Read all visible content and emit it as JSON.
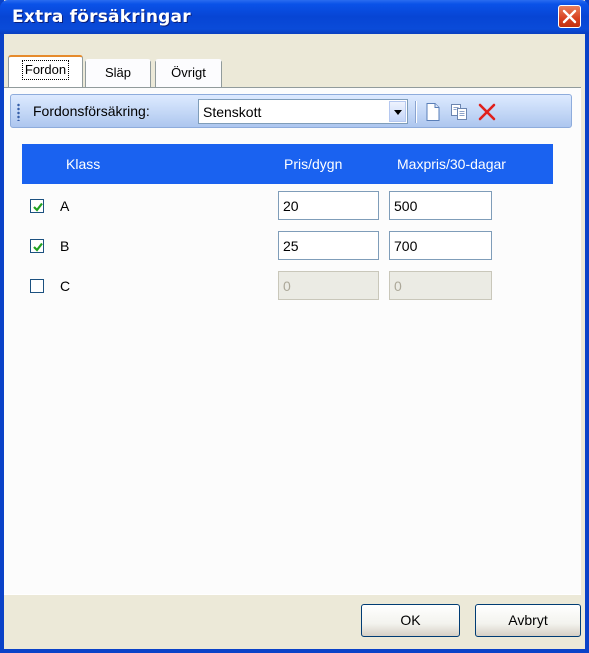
{
  "window": {
    "title": "Extra försäkringar"
  },
  "tabs": [
    {
      "label": "Fordon",
      "active": true
    },
    {
      "label": "Släp",
      "active": false
    },
    {
      "label": "Övrigt",
      "active": false
    }
  ],
  "toolbar": {
    "label": "Fordonsförsäkring:",
    "combo_value": "Stenskott",
    "icons": [
      "new-document-icon",
      "copy-icon",
      "delete-icon"
    ]
  },
  "grid": {
    "columns": {
      "klass": "Klass",
      "pris": "Pris/dygn",
      "maxpris": "Maxpris/30-dagar"
    },
    "rows": [
      {
        "klass": "A",
        "checked": true,
        "pris": "20",
        "maxpris": "500",
        "enabled": true
      },
      {
        "klass": "B",
        "checked": true,
        "pris": "25",
        "maxpris": "700",
        "enabled": true
      },
      {
        "klass": "C",
        "checked": false,
        "pris": "0",
        "maxpris": "0",
        "enabled": false
      }
    ]
  },
  "buttons": {
    "ok": "OK",
    "cancel": "Avbryt"
  },
  "colors": {
    "titlebar": "#0745d4",
    "grid_header": "#1a62f0",
    "delete": "#e0201b"
  }
}
